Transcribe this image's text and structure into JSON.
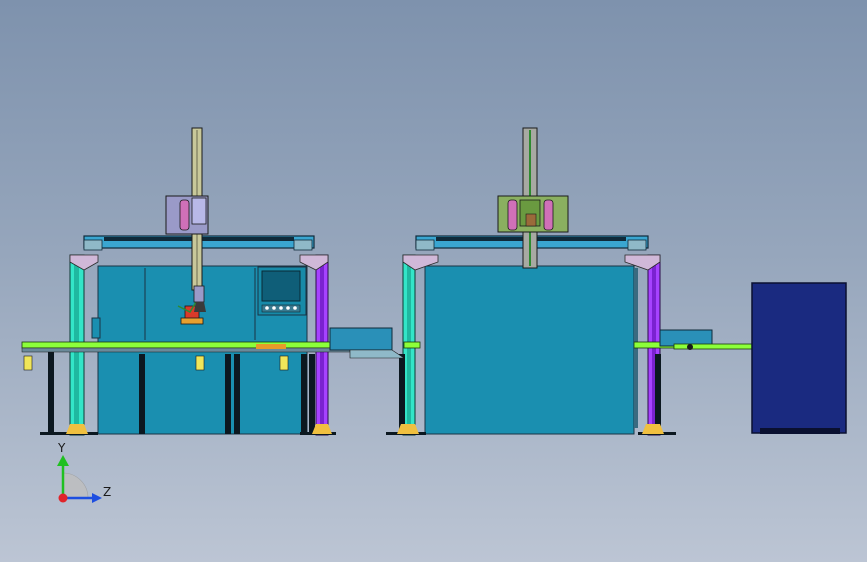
{
  "colors": {
    "machine_body": "#1a8fb0",
    "machine_edge": "#1a3344",
    "gantry_cyan": "#33e5c8",
    "gantry_purple": "#a642ff",
    "beam_blue": "#3aa6d1",
    "beam_dark": "#0f2a3a",
    "conveyor_green": "#8cff3a",
    "conveyor_yellow": "#f0e65a",
    "cabinet_navy": "#1a2a80",
    "leg_dark": "#0c1820",
    "column_khaki": "#c8c89a",
    "column_gray": "#a7a9a2",
    "accent_orange": "#e89b2a",
    "accent_red": "#d93a2a"
  },
  "scene": {
    "stations": [
      {
        "name": "station-1",
        "has_control_panel": true
      },
      {
        "name": "station-2",
        "has_control_panel": false
      }
    ],
    "has_output_cabinet": true
  },
  "triad": {
    "y_label": "Y",
    "z_label": "Z",
    "x_color": "#e0242a",
    "y_color": "#20c020",
    "z_color": "#1d4ee0"
  }
}
